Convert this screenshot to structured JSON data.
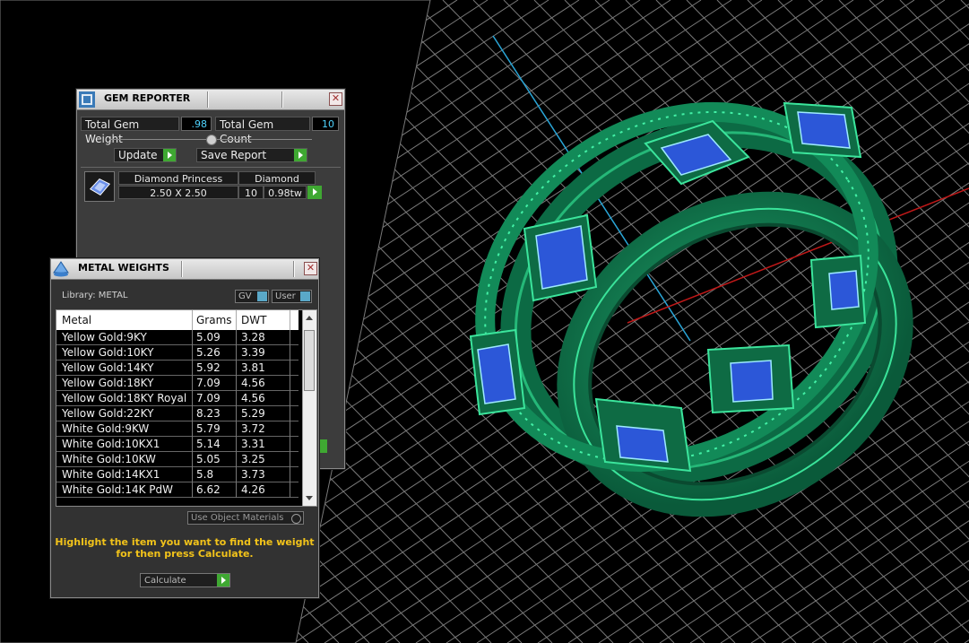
{
  "gem_reporter": {
    "title": "GEM REPORTER",
    "close_label": "✕",
    "total_weight_label": "Total Gem Weight",
    "total_weight_value": ".98",
    "total_count_label": "Total Gem Count",
    "total_count_value": "10",
    "update_label": "Update",
    "save_report_label": "Save Report",
    "gem": {
      "shape": "Diamond Princess",
      "material": "Diamond",
      "size": "2.50 X 2.50",
      "count": "10",
      "weight": "0.98tw"
    }
  },
  "metal_weights": {
    "title": "METAL WEIGHTS",
    "close_label": "✕",
    "library_label": "Library: METAL",
    "gv_label": "GV",
    "user_label": "User",
    "columns": [
      "Metal",
      "Grams",
      "DWT"
    ],
    "rows": [
      {
        "metal": "Yellow Gold:9KY",
        "grams": "5.09",
        "dwt": "3.28"
      },
      {
        "metal": "Yellow Gold:10KY",
        "grams": "5.26",
        "dwt": "3.39"
      },
      {
        "metal": "Yellow Gold:14KY",
        "grams": "5.92",
        "dwt": "3.81"
      },
      {
        "metal": "Yellow Gold:18KY",
        "grams": "7.09",
        "dwt": "4.56"
      },
      {
        "metal": "Yellow Gold:18KY Royal",
        "grams": "7.09",
        "dwt": "4.56"
      },
      {
        "metal": "Yellow Gold:22KY",
        "grams": "8.23",
        "dwt": "5.29"
      },
      {
        "metal": "White Gold:9KW",
        "grams": "5.79",
        "dwt": "3.72"
      },
      {
        "metal": "White Gold:10KX1",
        "grams": "5.14",
        "dwt": "3.31"
      },
      {
        "metal": "White Gold:10KW",
        "grams": "5.05",
        "dwt": "3.25"
      },
      {
        "metal": "White Gold:14KX1",
        "grams": "5.8",
        "dwt": "3.73"
      },
      {
        "metal": "White Gold:14K PdW",
        "grams": "6.62",
        "dwt": "4.26"
      }
    ],
    "use_object_materials_label": "Use Object Materials",
    "hint_line1": "Highlight the item you want to find the weight",
    "hint_line2": "for then press Calculate.",
    "calculate_label": "Calculate"
  },
  "colors": {
    "viewport_bg": "#000000",
    "grid": "#9a9a9a",
    "ring": "#0f7a4f",
    "ring_highlight": "#2fd18a",
    "gem": "#3a5ee0",
    "hint_text": "#f2c31a",
    "accent_button": "#3fa832"
  }
}
